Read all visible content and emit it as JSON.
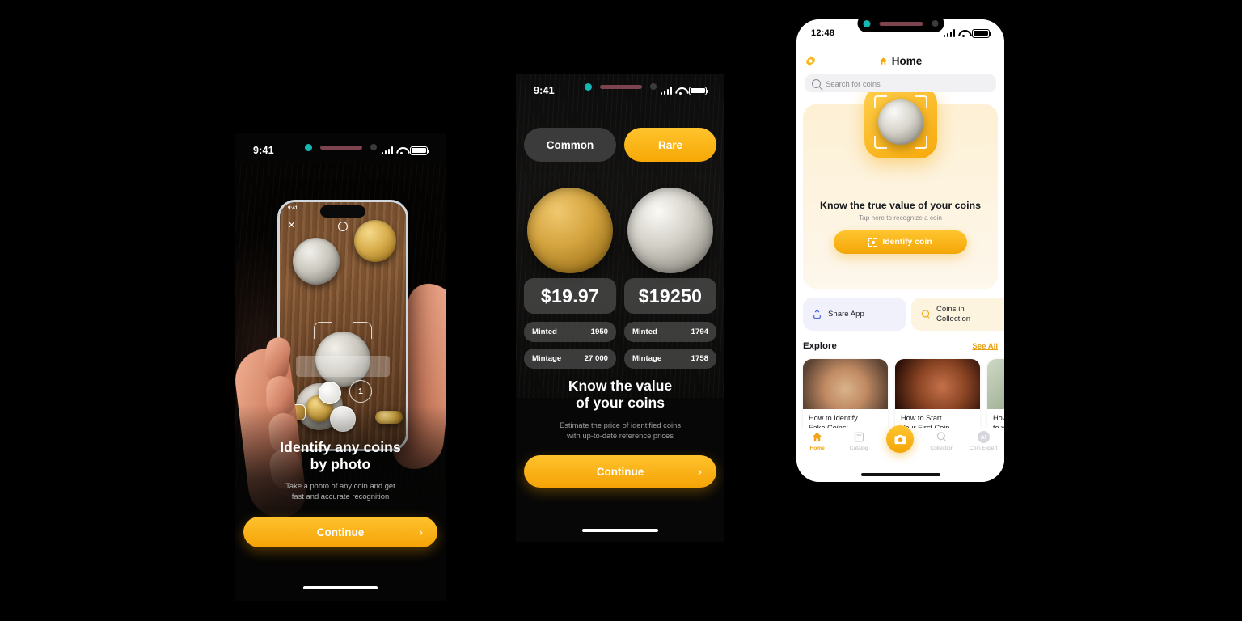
{
  "screen1": {
    "status": {
      "time": "9:41"
    },
    "title_line1": "Identify any coins",
    "title_line2": "by photo",
    "subtitle_line1": "Take a photo of any coin and get",
    "subtitle_line2": "fast and accurate recognition",
    "cta_label": "Continue",
    "cta_chevron": "chevron-right-icon",
    "inner_phone": {
      "time": "9:41",
      "close_icon": "close-icon",
      "flash_icon": "flash-icon",
      "level_label": "1"
    }
  },
  "screen2": {
    "status": {
      "time": "9:41"
    },
    "segments": [
      {
        "label": "Common",
        "selected": false
      },
      {
        "label": "Rare",
        "selected": true
      }
    ],
    "coins": [
      {
        "kind": "gold",
        "price": "$19.97",
        "rows": [
          {
            "label": "Minted",
            "value": "1950"
          },
          {
            "label": "Mintage",
            "value": "27 000"
          }
        ]
      },
      {
        "kind": "silver",
        "price": "$19250",
        "rows": [
          {
            "label": "Minted",
            "value": "1794"
          },
          {
            "label": "Mintage",
            "value": "1758"
          }
        ]
      }
    ],
    "title_line1": "Know the value",
    "title_line2": "of your coins",
    "subtitle_line1": "Estimate the price of identified coins",
    "subtitle_line2": "with up-to-date reference prices",
    "cta_label": "Continue",
    "cta_chevron": "chevron-right-icon"
  },
  "screen3": {
    "status": {
      "time": "12:48"
    },
    "header": {
      "settings_icon": "gear-icon",
      "home_icon": "home-icon",
      "title": "Home"
    },
    "search": {
      "placeholder": "Search for coins",
      "icon": "search-icon"
    },
    "hero": {
      "icon": "coin-scan-icon",
      "title": "Know the true value of your coins",
      "subtitle": "Tap here to recognize a coin",
      "button_label": "Identify coin",
      "button_icon": "scan-icon"
    },
    "quick_actions": [
      {
        "label": "Share App",
        "icon": "share-icon"
      },
      {
        "label": "Coins in\nCollection",
        "icon": "coin-icon"
      }
    ],
    "explore": {
      "title": "Explore",
      "see_all": "See All",
      "cards": [
        {
          "caption_line1": "How to Identify",
          "caption_line2": "Fake Coins:"
        },
        {
          "caption_line1": "How to Start",
          "caption_line2": "Your First Coin"
        },
        {
          "caption_line1": "How",
          "caption_line2": "to v"
        }
      ]
    },
    "tabs": [
      {
        "label": "Home",
        "icon": "home-icon",
        "active": true
      },
      {
        "label": "Catalog",
        "icon": "book-icon",
        "active": false
      },
      {
        "label": "",
        "icon": "camera-icon",
        "active": false
      },
      {
        "label": "Collection",
        "icon": "collection-icon",
        "active": false
      },
      {
        "label": "Coin Expert",
        "icon": "ai-icon",
        "active": false
      }
    ]
  },
  "colors": {
    "accent": "#f5a806",
    "accent_light": "#ffc42d",
    "background": "#000000",
    "card_cream": "#fdf0d4",
    "text_dark": "#16181d"
  }
}
